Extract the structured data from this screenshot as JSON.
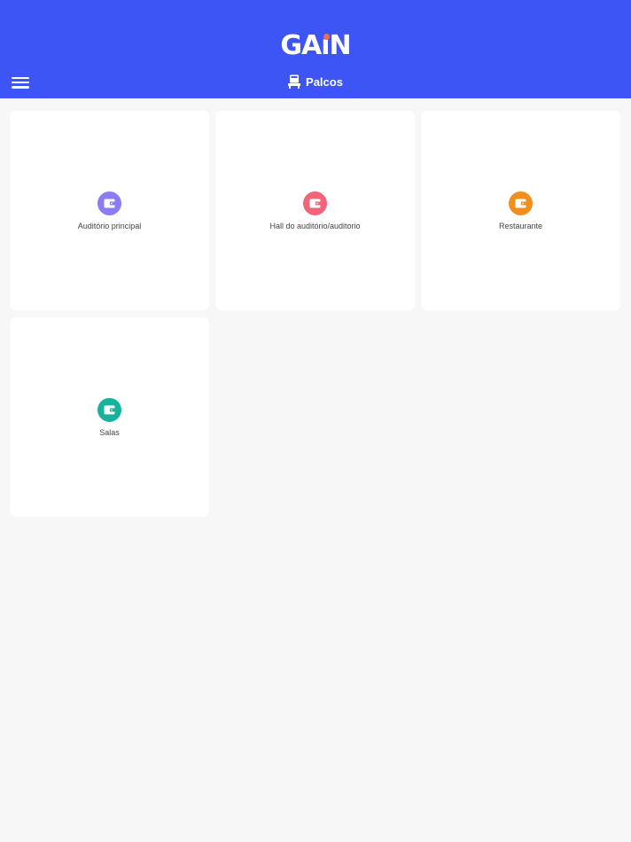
{
  "header": {
    "logo": {
      "left": "GA",
      "i": "ı",
      "right": "N"
    },
    "title": "Palcos",
    "background": "#3d55f5",
    "logo_dot_color": "#f36b4a",
    "menu_icon": "hamburger-menu-icon",
    "title_icon": "stage-icon"
  },
  "cards": [
    {
      "label": "Auditório principal",
      "icon": "wallet-icon",
      "color": "#8c7cf3"
    },
    {
      "label": "Hall do auditório/auditorio",
      "icon": "wallet-icon",
      "color": "#f2647a"
    },
    {
      "label": "Restaurante",
      "icon": "wallet-icon",
      "color": "#f28e1e"
    },
    {
      "label": "Salas",
      "icon": "wallet-icon",
      "color": "#16b39c"
    }
  ]
}
